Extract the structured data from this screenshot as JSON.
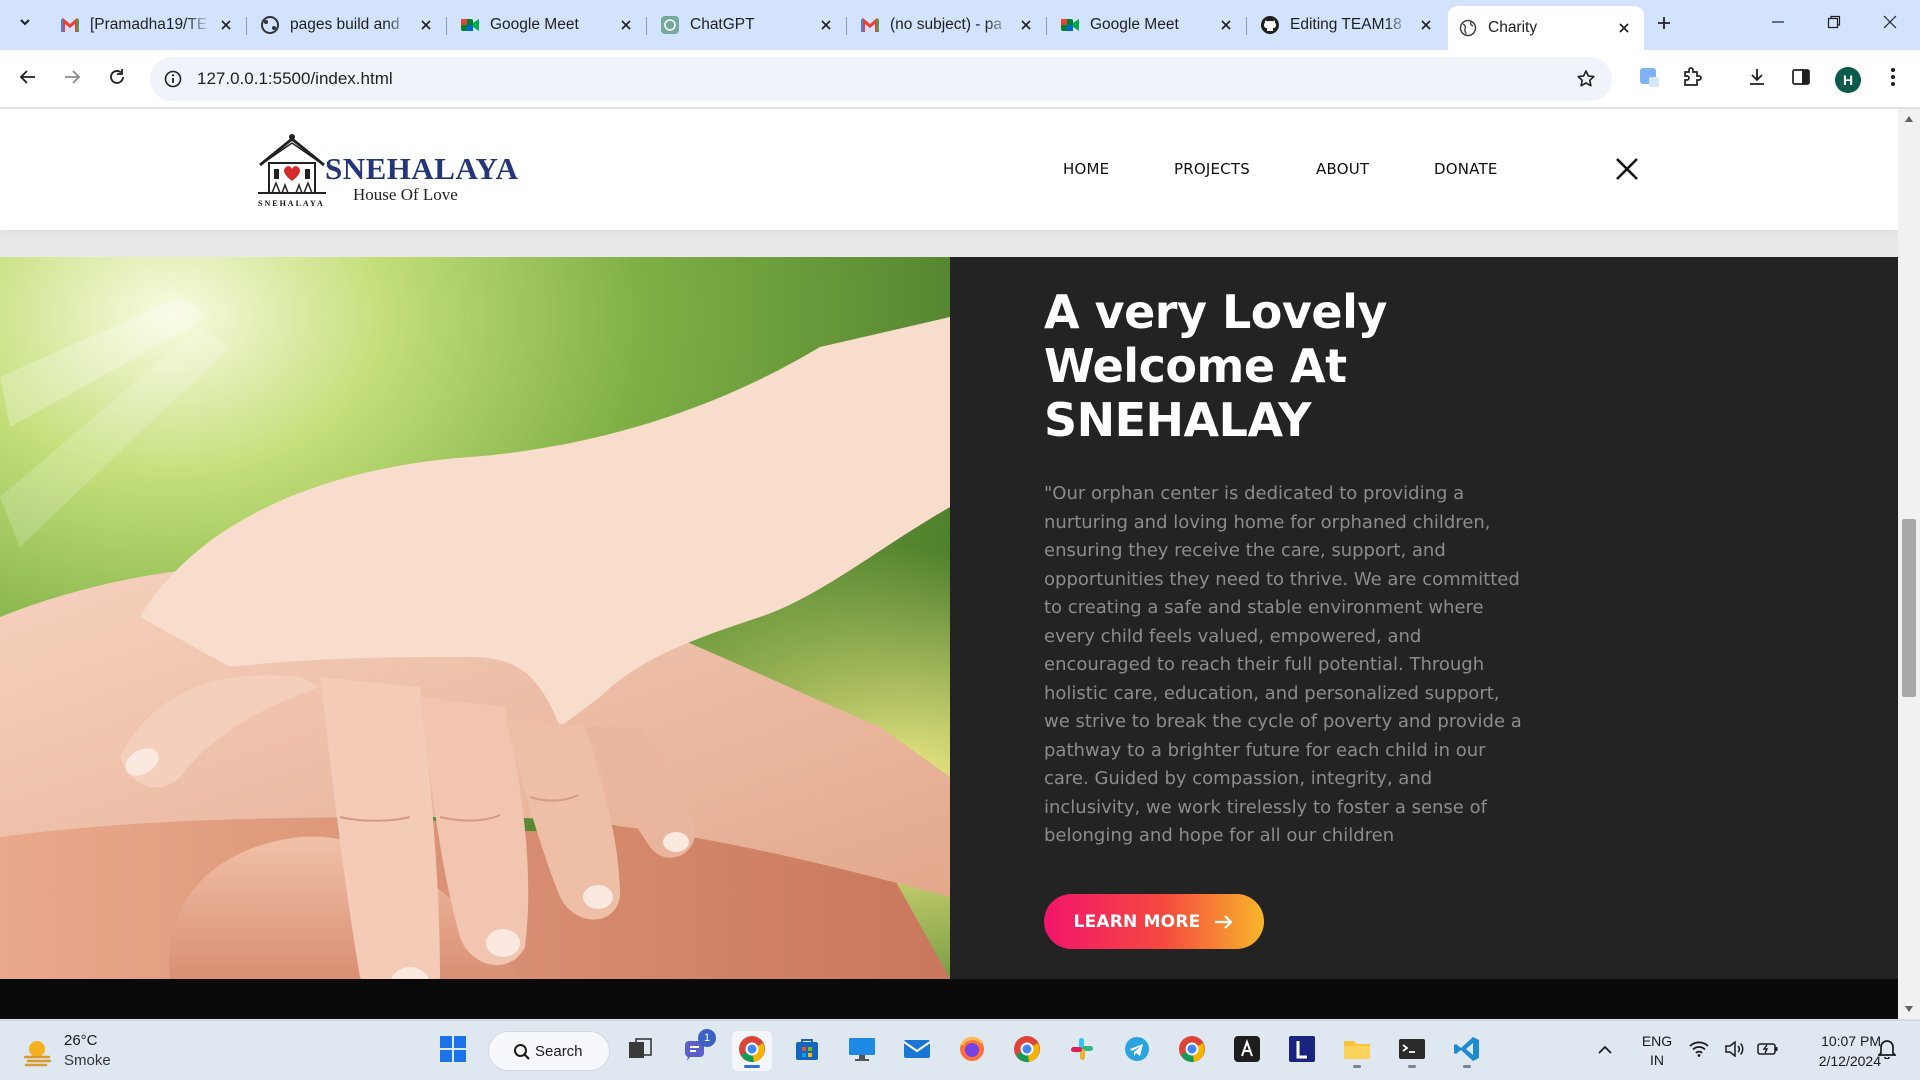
{
  "browser": {
    "tabs": [
      {
        "title": "[Pramadha19/TE",
        "icon": "gmail-icon"
      },
      {
        "title": "pages build and",
        "icon": "github-actions-icon"
      },
      {
        "title": "Google Meet",
        "icon": "google-meet-icon"
      },
      {
        "title": "ChatGPT",
        "icon": "chatgpt-icon"
      },
      {
        "title": "(no subject) - pa",
        "icon": "gmail-icon"
      },
      {
        "title": "Google Meet",
        "icon": "google-meet-icon"
      },
      {
        "title": "Editing TEAM18",
        "icon": "github-icon"
      },
      {
        "title": "Charity",
        "icon": "globe-icon",
        "active": true
      }
    ],
    "url": "127.0.0.1:5500/index.html",
    "profile_initial": "H"
  },
  "site": {
    "logo": {
      "brand": "SNEHALAYA",
      "tagline": "House Of Love",
      "small_text": "SNEHALAYA"
    },
    "nav": [
      "HOME",
      "PROJECTS",
      "ABOUT",
      "DONATE"
    ],
    "hero": {
      "title": "A very Lovely Welcome At SNEHALAY",
      "body": "\"Our orphan center is dedicated to providing a nurturing and loving home for orphaned children, ensuring they receive the care, support, and opportunities they need to thrive. We are committed to creating a safe and stable environment where every child feels valued, empowered, and encouraged to reach their full potential. Through holistic care, education, and personalized support, we strive to break the cycle of poverty and provide a pathway to a brighter future for each child in our care. Guided by compassion, integrity, and inclusivity, we work tirelessly to foster a sense of belonging and hope for all our children",
      "button": "LEARN MORE"
    },
    "colors": {
      "brand": "#24357a",
      "panel": "#232323",
      "button_start": "#f2146b",
      "button_end": "#f8b62a"
    }
  },
  "taskbar": {
    "weather": {
      "temp": "26°C",
      "condition": "Smoke"
    },
    "search_label": "Search",
    "teams_badge": "1",
    "language": {
      "line1": "ENG",
      "line2": "IN"
    },
    "time": "10:07 PM",
    "date": "2/12/2024"
  }
}
